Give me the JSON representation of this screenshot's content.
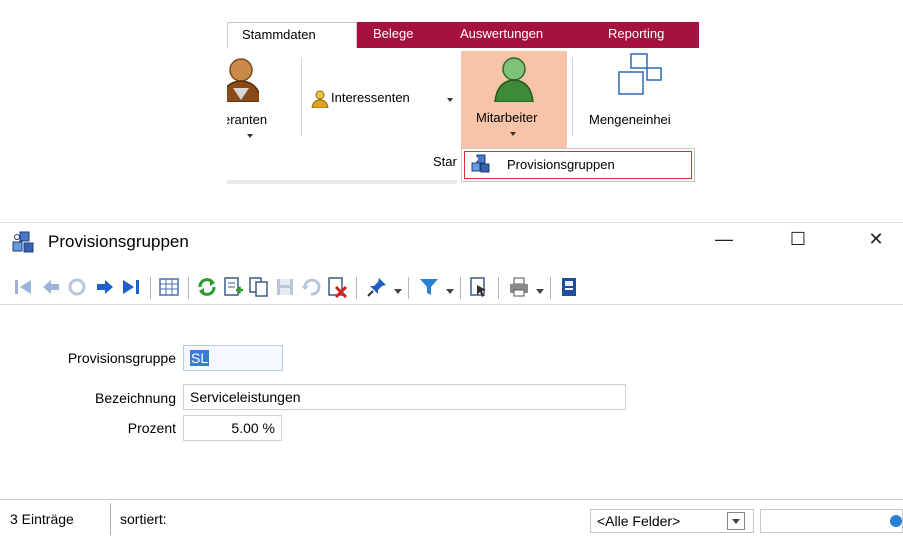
{
  "ribbon": {
    "tabs": [
      {
        "label": "Stammdaten",
        "active": true
      },
      {
        "label": "Belege",
        "active": false
      },
      {
        "label": "Auswertungen",
        "active": false
      },
      {
        "label": "Reporting",
        "active": false
      }
    ],
    "lieferanten_label": "eranten",
    "interessenten_label": "Interessenten",
    "mitarbeiter_label": "Mitarbeiter",
    "mengeneinheit_label": "Mengeneinhei",
    "group_label": "Star",
    "dropdown_item": "Provisionsgruppen",
    "accent_color": "#a5123f",
    "hover_color": "#f7c4a8"
  },
  "window": {
    "title": "Provisionsgruppen",
    "controls": {
      "minimize": "—",
      "maximize": "☐",
      "close": "✕"
    },
    "toolbar_icons": [
      "first-record-icon",
      "previous-record-icon",
      "undo-disabled-icon",
      "next-record-icon",
      "last-record-icon",
      "table-view-icon",
      "refresh-icon",
      "new-record-icon",
      "copy-record-icon",
      "save-icon",
      "revert-icon",
      "delete-icon",
      "pin-icon",
      "filter-icon",
      "export-icon",
      "print-icon",
      "notes-icon"
    ]
  },
  "form": {
    "provisionsgruppe_label": "Provisionsgruppe",
    "provisionsgruppe_value": "SL",
    "bezeichnung_label": "Bezeichnung",
    "bezeichnung_value": "Serviceleistungen",
    "prozent_label": "Prozent",
    "prozent_value": "5.00 %"
  },
  "status": {
    "count": "3 Einträge",
    "sort_label": "sortiert:",
    "field_filter": "<Alle Felder>"
  }
}
